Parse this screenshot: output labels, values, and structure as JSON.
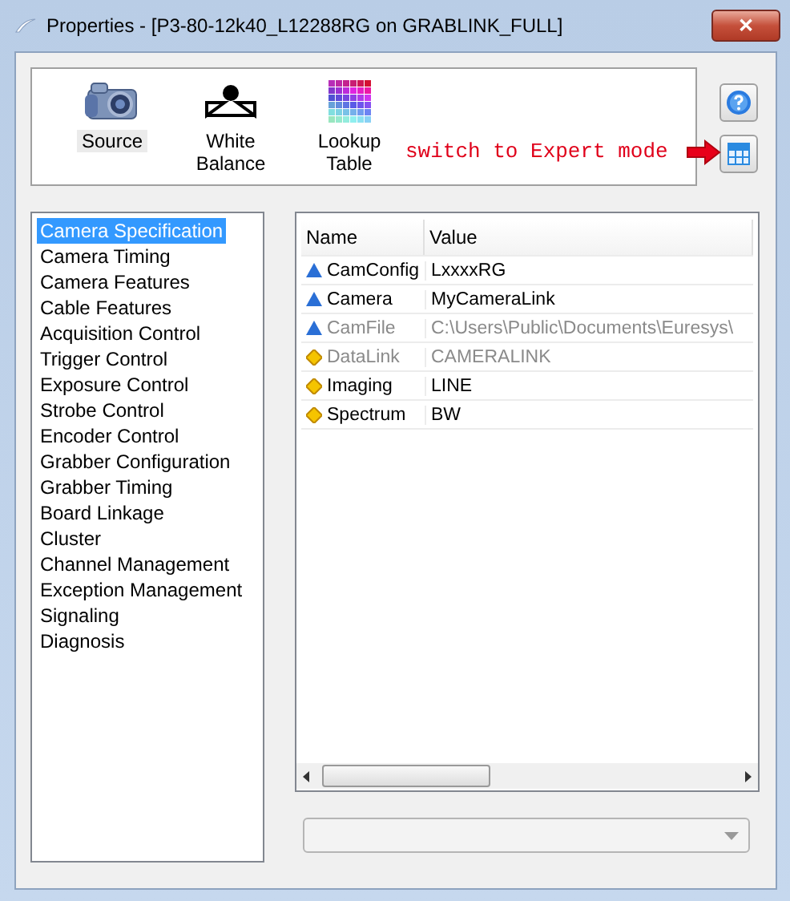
{
  "window": {
    "title": "Properties - [P3-80-12k40_L12288RG on GRABLINK_FULL]",
    "close": "✕"
  },
  "toolbar": [
    {
      "kind": "camera",
      "label": "Source",
      "selected": true
    },
    {
      "kind": "balance",
      "label": "White Balance",
      "selected": false
    },
    {
      "kind": "lut",
      "label": "Lookup Table",
      "selected": false
    }
  ],
  "annotation": "switch to Expert mode",
  "categories": [
    {
      "label": "Camera Specification",
      "selected": true
    },
    {
      "label": "Camera Timing",
      "selected": false
    },
    {
      "label": "Camera Features",
      "selected": false
    },
    {
      "label": "Cable Features",
      "selected": false
    },
    {
      "label": "Acquisition Control",
      "selected": false
    },
    {
      "label": "Trigger Control",
      "selected": false
    },
    {
      "label": "Exposure Control",
      "selected": false
    },
    {
      "label": "Strobe Control",
      "selected": false
    },
    {
      "label": "Encoder Control",
      "selected": false
    },
    {
      "label": "Grabber Configuration",
      "selected": false
    },
    {
      "label": "Grabber Timing",
      "selected": false
    },
    {
      "label": "Board Linkage",
      "selected": false
    },
    {
      "label": "Cluster",
      "selected": false
    },
    {
      "label": "Channel Management",
      "selected": false
    },
    {
      "label": "Exception Management",
      "selected": false
    },
    {
      "label": "Signaling",
      "selected": false
    },
    {
      "label": "Diagnosis",
      "selected": false
    }
  ],
  "grid": {
    "columns": [
      "Name",
      "Value"
    ],
    "rows": [
      {
        "kind": "triangle",
        "name": "CamConfig",
        "value": "LxxxxRG",
        "disabled": false
      },
      {
        "kind": "triangle",
        "name": "Camera",
        "value": "MyCameraLink",
        "disabled": false
      },
      {
        "kind": "triangle",
        "name": "CamFile",
        "value": "C:\\Users\\Public\\Documents\\Euresys\\",
        "disabled": true
      },
      {
        "kind": "diamond",
        "name": "DataLink",
        "value": "CAMERALINK",
        "disabled": true
      },
      {
        "kind": "diamond",
        "name": "Imaging",
        "value": "LINE",
        "disabled": false
      },
      {
        "kind": "diamond",
        "name": "Spectrum",
        "value": "BW",
        "disabled": false
      }
    ]
  }
}
